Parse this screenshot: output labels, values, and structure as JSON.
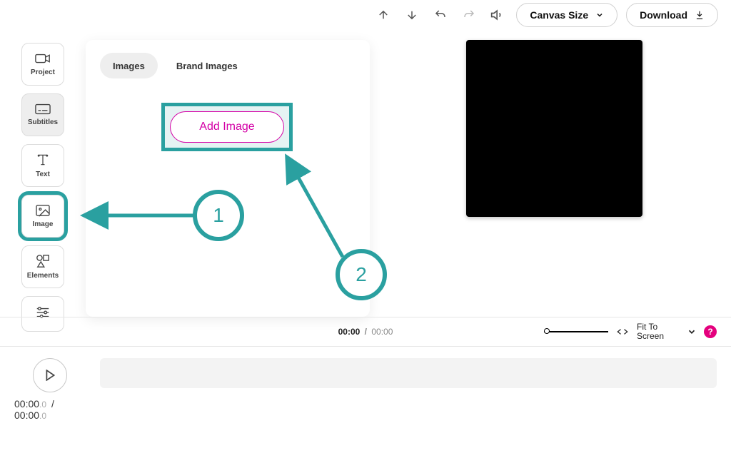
{
  "colors": {
    "teal": "#2aa0a0",
    "magenta": "#d400a6",
    "help_pink": "#e4007d"
  },
  "toolbar": {
    "canvas_size_label": "Canvas Size",
    "download_label": "Download"
  },
  "sidebar": {
    "items": [
      {
        "key": "project",
        "label": "Project"
      },
      {
        "key": "subtitles",
        "label": "Subtitles"
      },
      {
        "key": "text",
        "label": "Text"
      },
      {
        "key": "image",
        "label": "Image"
      },
      {
        "key": "elements",
        "label": "Elements"
      },
      {
        "key": "settings",
        "label": ""
      }
    ],
    "highlighted_key": "image"
  },
  "panel": {
    "tabs": {
      "images": "Images",
      "brand_images": "Brand Images",
      "active": "images"
    },
    "add_image_label": "Add Image"
  },
  "annotations": {
    "step1": "1",
    "step2": "2"
  },
  "midbar": {
    "current_time": "00:00",
    "separator": "/",
    "duration": "00:00",
    "fit_label": "Fit To Screen",
    "help": "?"
  },
  "timeline": {
    "current": "00:00",
    "current_ms": ".0",
    "sep": "/",
    "duration": "00:00",
    "duration_ms": ".0"
  }
}
